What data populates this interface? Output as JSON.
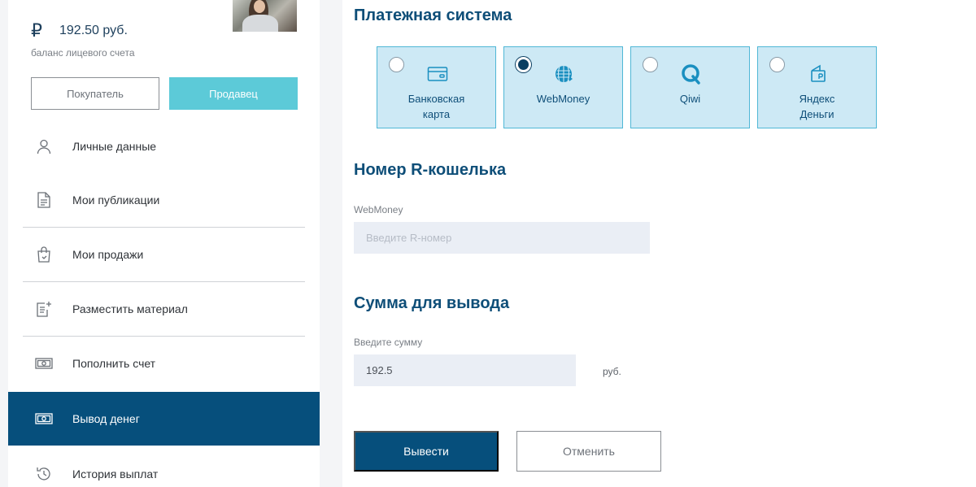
{
  "sidebar": {
    "balance": {
      "currency_symbol": "₽",
      "amount": "192.50 руб.",
      "caption": "баланс лицевого счета"
    },
    "roles": {
      "buyer": "Покупатель",
      "seller": "Продавец",
      "active": "seller"
    },
    "menu": [
      {
        "label": "Личные данные",
        "icon": "user-icon"
      },
      {
        "label": "Мои публикации",
        "icon": "document-icon"
      },
      {
        "label": "Мои продажи",
        "icon": "shopping-bag-icon"
      },
      {
        "label": "Разместить материал",
        "icon": "add-document-icon"
      },
      {
        "label": "Пополнить счет",
        "icon": "banknote-icon"
      },
      {
        "label": "Вывод денег",
        "icon": "banknote-icon",
        "active": true
      },
      {
        "label": "История выплат",
        "icon": "history-icon"
      }
    ]
  },
  "main": {
    "payment_system": {
      "title": "Платежная система",
      "options": [
        {
          "label": "Банковская\nкарта",
          "icon": "bank-card-icon",
          "selected": false
        },
        {
          "label": "WebMoney",
          "icon": "webmoney-icon",
          "selected": true
        },
        {
          "label": "Qiwi",
          "icon": "qiwi-icon",
          "selected": false
        },
        {
          "label": "Яндекс\nДеньги",
          "icon": "yandex-money-icon",
          "selected": false
        }
      ]
    },
    "wallet": {
      "title": "Номер R-кошелька",
      "label": "WebMoney",
      "placeholder": "Введите R-номер",
      "value": ""
    },
    "amount": {
      "title": "Сумма для вывода",
      "label": "Введите сумму",
      "value": "192.5",
      "unit": "руб."
    },
    "actions": {
      "submit": "Вывести",
      "cancel": "Отменить"
    }
  },
  "colors": {
    "primary": "#064f7c",
    "accent": "#5ccad8",
    "card_bg": "#cde9f5",
    "card_border": "#4fb7d6",
    "heading": "#0e4e78",
    "field_bg": "#eaeef5"
  }
}
